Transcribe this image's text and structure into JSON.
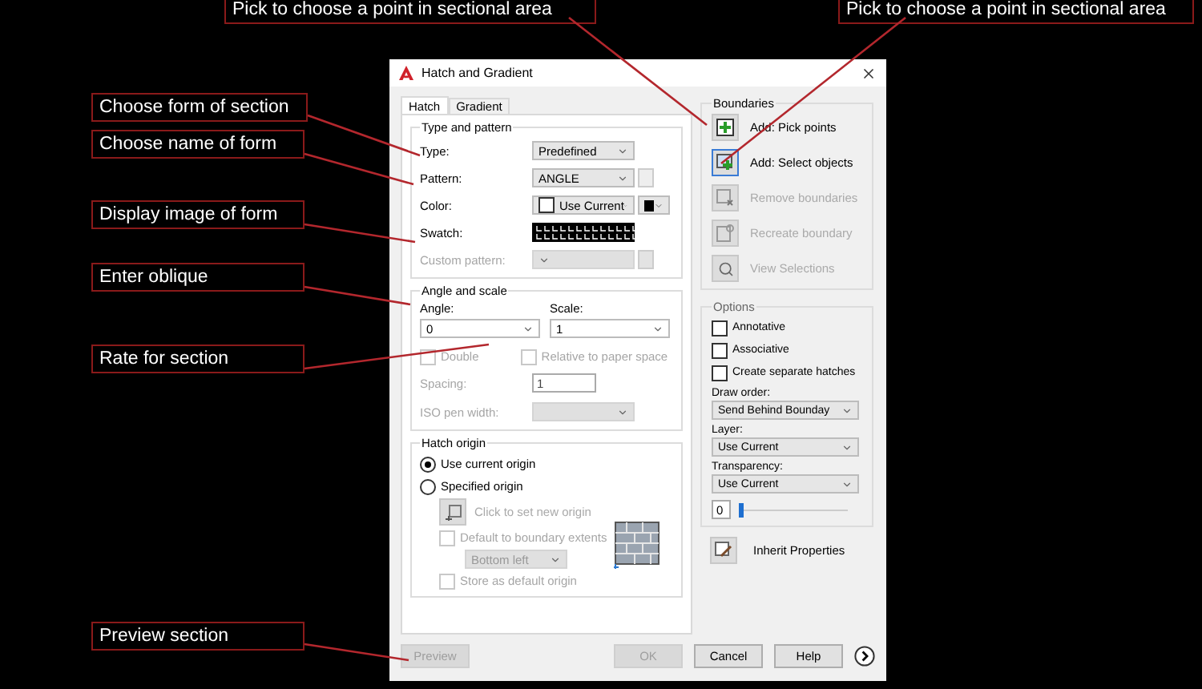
{
  "callouts": [
    {
      "text": "Pick to choose a point in sectional area"
    },
    {
      "text": "Pick to choose a point in sectional area"
    },
    {
      "text": "Choose form of section"
    },
    {
      "text": "Choose name of form"
    },
    {
      "text": "Display image of form"
    },
    {
      "text": "Enter oblique"
    },
    {
      "text": "Rate for section"
    },
    {
      "text": "Preview section"
    }
  ],
  "dialog": {
    "title": "Hatch and Gradient",
    "tabs": [
      {
        "label": "Hatch",
        "selected": true
      },
      {
        "label": "Gradient",
        "selected": false
      }
    ],
    "type_and_pattern": {
      "title": "Type and pattern",
      "rows": [
        {
          "kind": "dropdown",
          "label": "Type:",
          "value": "Predefined",
          "disabled": false
        },
        {
          "kind": "dropdown_more",
          "label": "Pattern:",
          "value": "ANGLE",
          "disabled": false
        },
        {
          "kind": "color",
          "label": "Color:",
          "value": "Use Current",
          "disabled": false
        },
        {
          "kind": "swatch",
          "label": "Swatch:",
          "disabled": false
        },
        {
          "kind": "dropdown_more",
          "label": "Custom pattern:",
          "disabled": true
        }
      ]
    },
    "angle_and_scale": {
      "title": "Angle and scale",
      "angle": {
        "label": "Angle:",
        "value": "0"
      },
      "scale": {
        "label": "Scale:",
        "value": "1"
      },
      "checks": [
        {
          "label": "Double",
          "checked": false,
          "disabled": true
        },
        {
          "label": "Relative to paper space",
          "checked": false,
          "disabled": true
        }
      ],
      "spacing": {
        "label": "Spacing:",
        "value": "1",
        "disabled": true
      },
      "iso_pen_width": {
        "label": "ISO pen width:",
        "disabled": true
      }
    },
    "hatch_origin": {
      "title": "Hatch origin",
      "radios": [
        {
          "label": "Use current origin",
          "selected": true
        },
        {
          "label": "Specified origin",
          "selected": false
        }
      ],
      "set_origin": {
        "label": "Click to set new origin",
        "disabled": true
      },
      "default_extents": {
        "label": "Default to boundary extents",
        "checked": false,
        "disabled": true
      },
      "position": {
        "value": "Bottom left",
        "disabled": true
      },
      "store": {
        "label": "Store as default origin",
        "checked": false,
        "disabled": true
      }
    },
    "boundaries": {
      "title": "Boundaries",
      "buttons": [
        {
          "kind": "pick",
          "label": "Add: Pick points",
          "disabled": false,
          "selected": false
        },
        {
          "kind": "select",
          "label": "Add: Select objects",
          "disabled": false,
          "selected": true
        },
        {
          "kind": "remove",
          "label": "Remove boundaries",
          "disabled": true,
          "selected": false
        },
        {
          "kind": "recreate",
          "label": "Recreate boundary",
          "disabled": true,
          "selected": false
        },
        {
          "kind": "view",
          "label": "View Selections",
          "disabled": true,
          "selected": false
        }
      ]
    },
    "options": {
      "title": "Options",
      "checks": [
        {
          "label": "Annotative",
          "checked": false
        },
        {
          "label": "Associative",
          "checked": false
        },
        {
          "label": "Create separate hatches",
          "checked": false
        }
      ],
      "selects": [
        {
          "label": "Draw order:",
          "value": "Send Behind Bounday"
        },
        {
          "label": "Layer:",
          "value": "Use Current"
        },
        {
          "label": "Transparency:",
          "value": "Use Current"
        }
      ],
      "transparency": {
        "value": "0",
        "level": 0
      }
    },
    "inherit": {
      "label": "Inherit Properties"
    },
    "footer_buttons": [
      {
        "label": "Preview",
        "disabled": true
      },
      {
        "label": "OK",
        "disabled": true
      },
      {
        "label": "Cancel",
        "disabled": false
      },
      {
        "label": "Help",
        "disabled": false
      }
    ]
  }
}
